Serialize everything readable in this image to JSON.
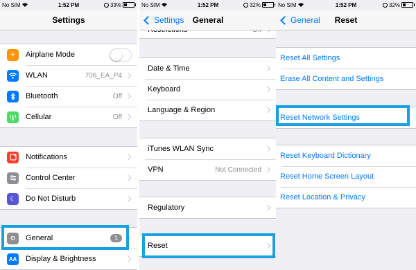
{
  "status_bar": {
    "carrier": "No SIM",
    "time": "1:52 PM"
  },
  "battery": {
    "p1": "33%",
    "p2": "32%",
    "p3": "32%"
  },
  "accent_color": "#007aff",
  "highlight_color": "#1a9fe0",
  "settings": {
    "title": "Settings",
    "group1": [
      {
        "label": "Airplane Mode",
        "icon": "airplane-icon",
        "icon_color": "#ff9500"
      },
      {
        "label": "WLAN",
        "value": "706_EA_P4",
        "icon": "wifi-icon",
        "icon_color": "#007aff"
      },
      {
        "label": "Bluetooth",
        "value": "Off",
        "icon": "bluetooth-icon",
        "icon_color": "#007aff"
      },
      {
        "label": "Cellular",
        "value": "Off",
        "icon": "cellular-icon",
        "icon_color": "#4cd964"
      }
    ],
    "group2": [
      {
        "label": "Notifications",
        "icon": "notifications-icon",
        "icon_color": "#ff3b30"
      },
      {
        "label": "Control Center",
        "icon": "control-center-icon",
        "icon_color": "#8e8e93"
      },
      {
        "label": "Do Not Disturb",
        "icon": "moon-icon",
        "icon_color": "#5856d6"
      }
    ],
    "group3": [
      {
        "label": "General",
        "badge": "1",
        "icon": "gear-icon",
        "icon_color": "#8e8e93"
      },
      {
        "label": "Display & Brightness",
        "icon": "display-icon",
        "icon_color": "#007aff"
      }
    ]
  },
  "general": {
    "title": "General",
    "back": "Settings",
    "partial_row": "Restrictions",
    "partial_value": "Off",
    "group1": [
      "Date & Time",
      "Keyboard",
      "Language & Region"
    ],
    "group2": [
      {
        "label": "iTunes WLAN Sync"
      },
      {
        "label": "VPN",
        "value": "Not Connected"
      }
    ],
    "group3": [
      "Regulatory"
    ],
    "group4": [
      "Reset"
    ]
  },
  "reset": {
    "title": "Reset",
    "back": "General",
    "group1": [
      "Reset All Settings",
      "Erase All Content and Settings"
    ],
    "group2": [
      "Reset Network Settings"
    ],
    "group3": [
      "Reset Keyboard Dictionary",
      "Reset Home Screen Layout",
      "Reset Location & Privacy"
    ]
  }
}
